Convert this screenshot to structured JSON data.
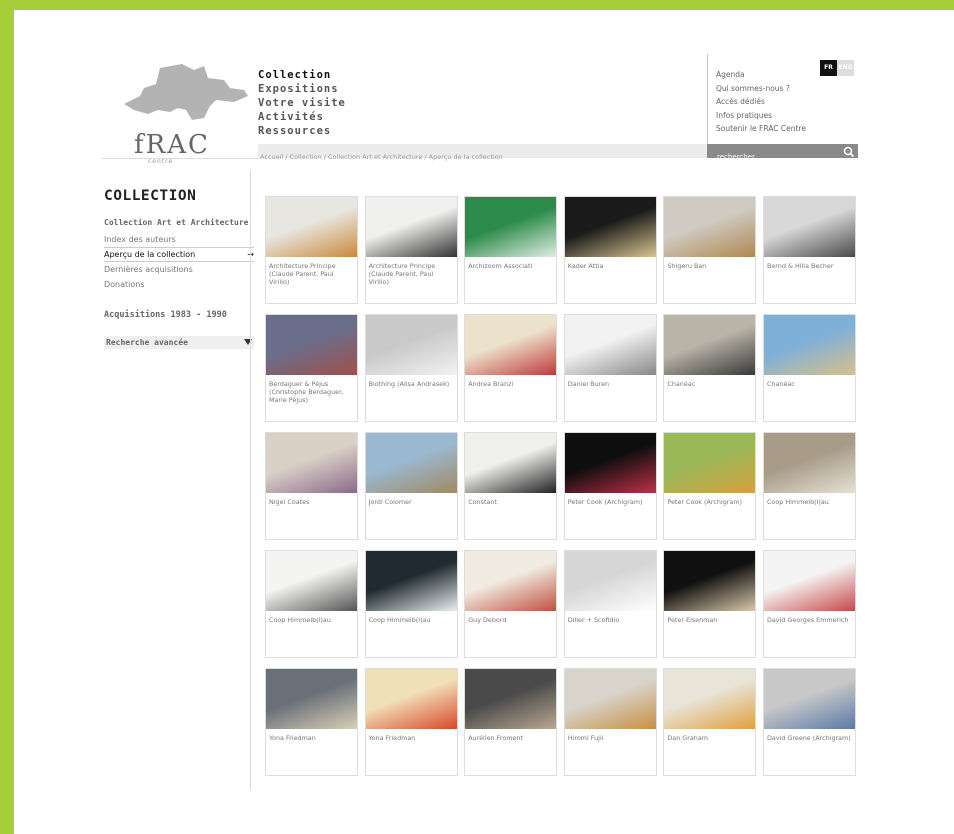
{
  "header": {
    "logo_text": "fRAC",
    "logo_sub": "centre",
    "main_nav": [
      "Collection",
      "Expositions",
      "Votre visite",
      "Activités",
      "Ressources"
    ],
    "util_nav": [
      "Agenda",
      "Qui sommes-nous ?",
      "Accès dédiés",
      "Infos pratiques",
      "Soutenir le FRAC Centre"
    ],
    "lang_fr": "FR",
    "lang_eng": "ENG",
    "breadcrumb": "Accueil / Collection / Collection Art et Architecture / Aperçu de la collection",
    "search_placeholder": "rechercher"
  },
  "sidebar": {
    "title": "COLLECTION",
    "group": "Collection Art et Architecture",
    "items": [
      "Index des auteurs",
      "Aperçu de la collection",
      "Dernières acquisitions",
      "Donations"
    ],
    "acquisitions": "Acquisitions 1983 - 1990",
    "advanced": "Recherche avancée",
    "active_arrow": "→"
  },
  "grid": [
    {
      "caption": "Architecture Principe (Claude Parent, Paul Virilio)",
      "c1": "#e8e6e0",
      "c2": "#c98a3a"
    },
    {
      "caption": "Architecture Principe (Claude Parent, Paul Virilio)",
      "c1": "#f0f0ee",
      "c2": "#333333"
    },
    {
      "caption": "Archizoom Associati",
      "c1": "#2c8a4a",
      "c2": "#e0eee2"
    },
    {
      "caption": "Kader Attia",
      "c1": "#1a1a1a",
      "c2": "#d9c590"
    },
    {
      "caption": "Shigeru Ban",
      "c1": "#cfcac2",
      "c2": "#b08850"
    },
    {
      "caption": "Bernd & Hilla Becher",
      "c1": "#d8d8d8",
      "c2": "#4a4a4a"
    },
    {
      "caption": "Berdaguer & Péjus (Christophe Berdaguer, Marie Péjus)",
      "c1": "#6a6e8a",
      "c2": "#a0504a"
    },
    {
      "caption": "Biothing (Alisa Andrasek)",
      "c1": "#c9c9c9",
      "c2": "#f2f2f2"
    },
    {
      "caption": "Andrea Branzi",
      "c1": "#ece2cc",
      "c2": "#c03a3a"
    },
    {
      "caption": "Daniel Buren",
      "c1": "#f2f2f2",
      "c2": "#888888"
    },
    {
      "caption": "Chanéac",
      "c1": "#b9b4a8",
      "c2": "#3a3a3a"
    },
    {
      "caption": "Chanéac",
      "c1": "#7fb0d8",
      "c2": "#d8c08a"
    },
    {
      "caption": "Nigel Coates",
      "c1": "#d9d0c6",
      "c2": "#8a6a8a"
    },
    {
      "caption": "Jordi Colomer",
      "c1": "#9ab8d0",
      "c2": "#a08a60"
    },
    {
      "caption": "Constant",
      "c1": "#f0f0ee",
      "c2": "#222222"
    },
    {
      "caption": "Peter Cook (Archigram)",
      "c1": "#0e0e0e",
      "c2": "#c03048"
    },
    {
      "caption": "Peter Cook (Archigram)",
      "c1": "#9ab858",
      "c2": "#d8a040"
    },
    {
      "caption": "Coop Himmelb(l)au",
      "c1": "#a89c88",
      "c2": "#e6e0d4"
    },
    {
      "caption": "Coop Himmelb(l)au",
      "c1": "#f4f4f2",
      "c2": "#555555"
    },
    {
      "caption": "Coop Himmelb(l)au",
      "c1": "#202a30",
      "c2": "#e8eef0"
    },
    {
      "caption": "Guy Debord",
      "c1": "#f0ece2",
      "c2": "#c05040"
    },
    {
      "caption": "Diller + Scofidio",
      "c1": "#d6d6d6",
      "c2": "#ffffff"
    },
    {
      "caption": "Peter Eisenman",
      "c1": "#101010",
      "c2": "#d8c8a8"
    },
    {
      "caption": "David Georges Emmerich",
      "c1": "#f4f4f4",
      "c2": "#c84848"
    },
    {
      "caption": "Yona Friedman",
      "c1": "#6a7078",
      "c2": "#d8cfb8"
    },
    {
      "caption": "Yona Friedman",
      "c1": "#f0e0b8",
      "c2": "#d84828"
    },
    {
      "caption": "Aurélien Froment",
      "c1": "#4a4a4a",
      "c2": "#b8a890"
    },
    {
      "caption": "Hiromi Fujii",
      "c1": "#d8d4cc",
      "c2": "#c89040"
    },
    {
      "caption": "Dan Graham",
      "c1": "#e8e4d8",
      "c2": "#e0a040"
    },
    {
      "caption": "David Greene (Archigram)",
      "c1": "#c8c8c8",
      "c2": "#5a7aa8"
    }
  ]
}
